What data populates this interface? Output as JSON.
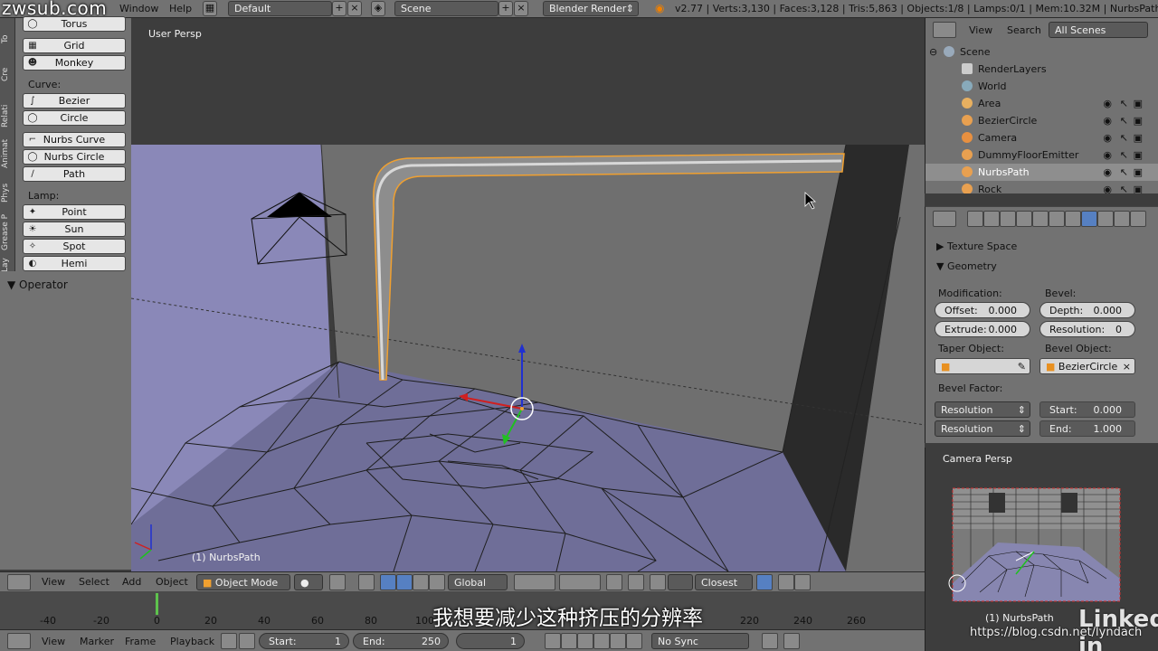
{
  "watermark_top": "zwsub.com",
  "topbar": {
    "menus": [
      "Window",
      "Help"
    ],
    "layout": "Default",
    "scene": "Scene",
    "engine": "Blender Render",
    "stats": "v2.77 | Verts:3,130 | Faces:3,128 | Tris:5,863 | Objects:1/8 | Lamps:0/1 | Mem:10.32M | NurbsPath"
  },
  "lefttabs": [
    "To",
    "Cre",
    "Relati",
    "Animat",
    "Phys",
    "Grease P",
    "Lay"
  ],
  "toolshelf": {
    "buttons_mesh": [
      "Torus",
      "Grid",
      "Monkey"
    ],
    "curve_label": "Curve:",
    "buttons_curve": [
      "Bezier",
      "Circle",
      "Nurbs Curve",
      "Nurbs Circle",
      "Path"
    ],
    "lamp_label": "Lamp:",
    "buttons_lamp": [
      "Point",
      "Sun",
      "Spot",
      "Hemi"
    ],
    "operator": "Operator"
  },
  "viewport": {
    "persp": "User Persp",
    "object": "(1) NurbsPath"
  },
  "vp_header": {
    "menus": [
      "View",
      "Select",
      "Add",
      "Object"
    ],
    "mode": "Object Mode",
    "orientation": "Global",
    "snap": "Closest"
  },
  "timeline": {
    "ticks": [
      "-40",
      "-20",
      "0",
      "20",
      "40",
      "60",
      "80",
      "100",
      "220",
      "240",
      "260"
    ],
    "subtitle": "我想要减少这种挤压的分辨率"
  },
  "bottombar": {
    "menus": [
      "View",
      "Marker",
      "Frame",
      "Playback"
    ],
    "start_label": "Start:",
    "start": "1",
    "end_label": "End:",
    "end": "250",
    "current": "1",
    "sync": "No Sync"
  },
  "outliner": {
    "menus": [
      "View",
      "Search"
    ],
    "filter": "All Scenes",
    "items": [
      "Scene",
      "RenderLayers",
      "World",
      "Area",
      "BezierCircle",
      "Camera",
      "DummyFloorEmitter",
      "NurbsPath",
      "Rock"
    ]
  },
  "props": {
    "texture_space": "Texture Space",
    "geometry": "Geometry",
    "modification": "Modification:",
    "bevel": "Bevel:",
    "offset_label": "Offset:",
    "offset": "0.000",
    "extrude_label": "Extrude:",
    "extrude": "0.000",
    "depth_label": "Depth:",
    "depth": "0.000",
    "resolution_label": "Resolution:",
    "resolution": "0",
    "taper_object": "Taper Object:",
    "bevel_object": "Bevel Object:",
    "bevel_object_value": "BezierCircle",
    "bevel_factor": "Bevel Factor:",
    "res_sel_1": "Resolution",
    "res_sel_2": "Resolution",
    "start_label": "Start:",
    "start": "0.000",
    "end_label": "End:",
    "end": "1.000"
  },
  "campreview": {
    "label": "Camera Persp",
    "object": "(1) NurbsPath"
  },
  "watermark_bottom": "https://blog.csdn.net/lyndach",
  "linkedin": "Linked in",
  "colors": {
    "selected_outline": "#f0a030",
    "header_gray": "#727272",
    "viewport_bg": "#3d3d3d"
  }
}
